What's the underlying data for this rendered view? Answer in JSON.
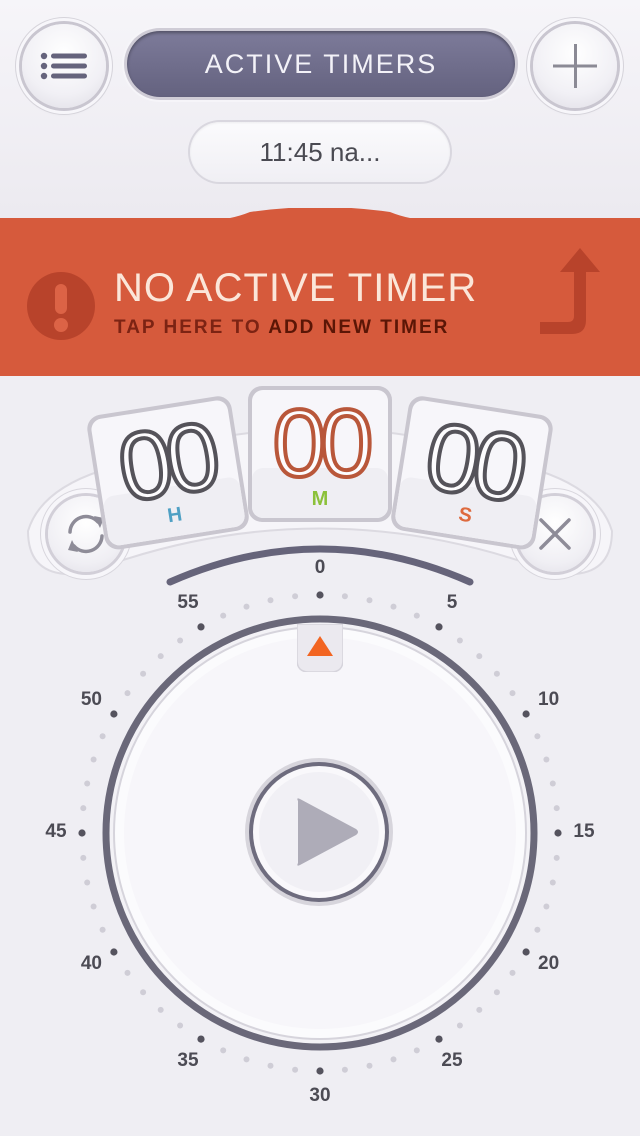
{
  "header": {
    "title": "ACTIVE TIMERS",
    "subtitle": "11:45 na...",
    "menu_icon": "list-icon",
    "add_icon": "plus-icon"
  },
  "banner": {
    "title": "NO ACTIVE TIMER",
    "subtitle_prefix": "TAP HERE TO",
    "subtitle_action": "ADD NEW TIMER",
    "color": "#d65a3c",
    "alert_icon": "exclamation-icon",
    "arrow_icon": "arrow-up-icon"
  },
  "timer": {
    "hours": "00",
    "minutes": "00",
    "seconds": "00",
    "hours_unit": "H",
    "minutes_unit": "M",
    "seconds_unit": "S",
    "hours_color": "#4fa0c4",
    "minutes_color": "#8cc13a",
    "seconds_color": "#de6a3e",
    "minutes_digit_color": "#b9573a"
  },
  "controls": {
    "reset_icon": "refresh-icon",
    "clear_icon": "close-icon",
    "play_icon": "play-icon",
    "pointer_icon": "triangle-pointer-icon"
  },
  "dial": {
    "labels": [
      "0",
      "5",
      "10",
      "15",
      "20",
      "25",
      "30",
      "35",
      "40",
      "45",
      "50",
      "55"
    ],
    "pointer_color": "#f26522"
  }
}
